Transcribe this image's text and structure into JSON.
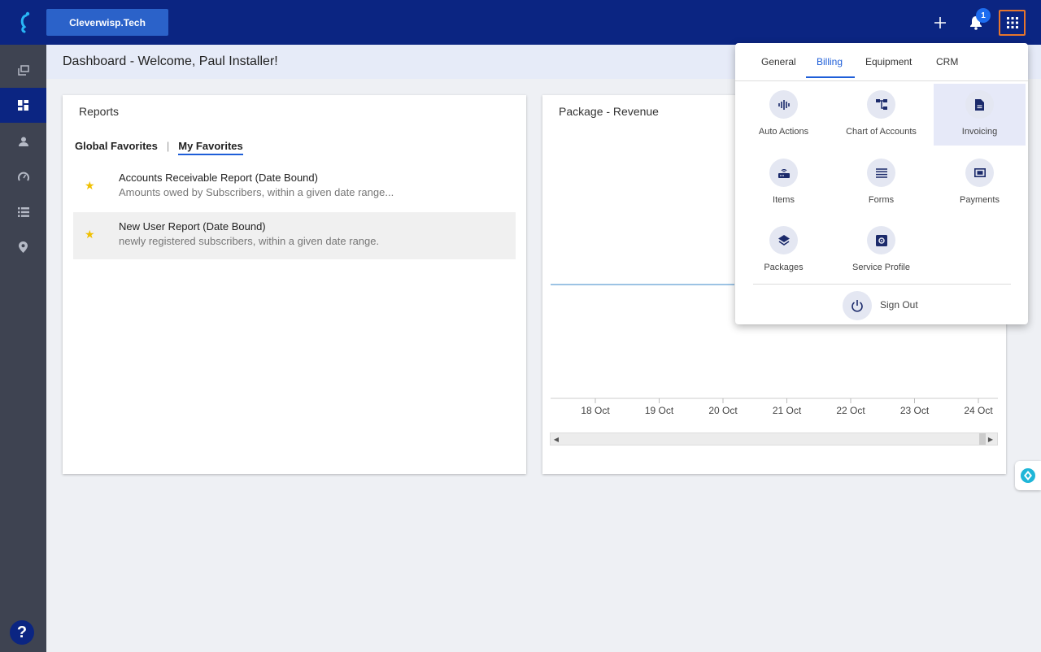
{
  "topbar": {
    "brand": "Cleverwisp.Tech",
    "notification_count": "1",
    "icons": [
      "logo-icon",
      "plus-icon",
      "bell-icon",
      "apps-grid-icon"
    ]
  },
  "sidebar": {
    "items": [
      {
        "name": "collections-icon",
        "active": false
      },
      {
        "name": "dashboard-icon",
        "active": true
      },
      {
        "name": "person-icon",
        "active": false
      },
      {
        "name": "speedometer-icon",
        "active": false
      },
      {
        "name": "list-icon",
        "active": false
      },
      {
        "name": "location-pin-icon",
        "active": false
      }
    ],
    "help": "?"
  },
  "header": {
    "welcome": "Dashboard - Welcome, Paul Installer!"
  },
  "reports": {
    "title": "Reports",
    "tabs": [
      "Global Favorites",
      "My Favorites"
    ],
    "tab_separator": "|",
    "active_tab": "My Favorites",
    "items": [
      {
        "title": "Accounts Receivable Report (Date Bound)",
        "description": "Amounts owed by Subscribers, within a given date range..."
      },
      {
        "title": "New User Report (Date Bound)",
        "description": "newly registered subscribers, within a given date range."
      }
    ]
  },
  "revenue": {
    "title": "Package - Revenue"
  },
  "chart_data": {
    "type": "line",
    "title": "Package - Revenue",
    "x": [
      "18 Oct",
      "19 Oct",
      "20 Oct",
      "21 Oct",
      "22 Oct",
      "23 Oct",
      "24 Oct"
    ],
    "series": [
      {
        "values": [
          0,
          0,
          0,
          0,
          0,
          0,
          0
        ]
      }
    ],
    "series_color": "#9cc3e4",
    "grid": false
  },
  "menu": {
    "tabs": [
      "General",
      "Billing",
      "Equipment",
      "CRM"
    ],
    "active_tab": "Billing",
    "items": [
      {
        "label": "Auto Actions",
        "icon": "waveform-icon"
      },
      {
        "label": "Chart of Accounts",
        "icon": "hierarchy-icon"
      },
      {
        "label": "Invoicing",
        "icon": "document-icon",
        "highlighted": true
      },
      {
        "label": "Items",
        "icon": "router-icon"
      },
      {
        "label": "Forms",
        "icon": "lines-icon"
      },
      {
        "label": "Payments",
        "icon": "money-icon"
      },
      {
        "label": "Packages",
        "icon": "layers-icon"
      },
      {
        "label": "Service Profile",
        "icon": "gear-box-icon"
      }
    ],
    "sign_out": "Sign Out"
  },
  "colors": {
    "topbar": "#0b2582",
    "sidebar": "#3e4351",
    "brand_button": "#2b62c9",
    "accent": "#1e5ed8",
    "star": "#f0c000"
  }
}
